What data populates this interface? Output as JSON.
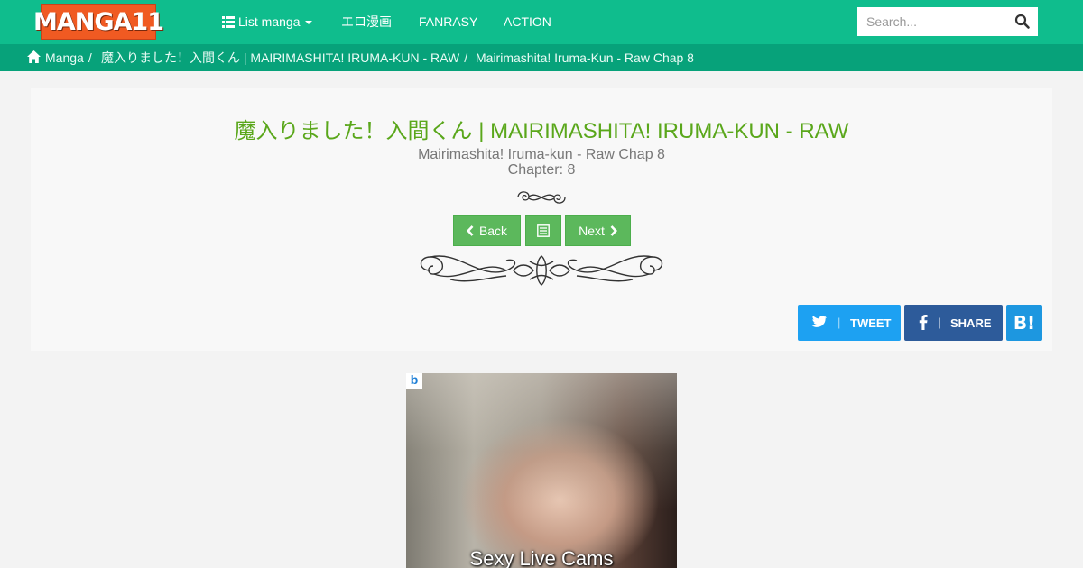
{
  "navbar": {
    "logo_text": "MANGA11",
    "links": {
      "list_manga": "List manga",
      "ero": "エロ漫画",
      "fanrasy": "FANRASY",
      "action": "ACTION"
    },
    "search_placeholder": "Search..."
  },
  "breadcrumb": {
    "items": [
      "Manga",
      "魔入りました！入間くん | MAIRIMASHITA! IRUMA-KUN - RAW",
      "Mairimashita! Iruma-Kun - Raw Chap 8"
    ]
  },
  "chapter": {
    "manga_title": "魔入りました！入間くん | MAIRIMASHITA! IRUMA-KUN - RAW",
    "chapter_title": "Mairimashita! Iruma-kun - Raw Chap 8",
    "chapter_number": "Chapter: 8",
    "back_label": "Back",
    "next_label": "Next"
  },
  "share": {
    "tweet_label": "TWEET",
    "share_label": "SHARE",
    "hatena_label": "B!"
  },
  "ad": {
    "badge": "b",
    "caption": "Sexy Live Cams"
  },
  "colors": {
    "navbar": "#0fbd8d",
    "breadcrumb": "#07a27a",
    "title": "#5aa71b",
    "button": "#5cb85c",
    "twitter": "#1da1f2",
    "facebook": "#2d5b9a",
    "hatena": "#1d97e0",
    "logo": "#f05a22"
  },
  "icons": [
    "list-icon",
    "caret-down-icon",
    "search-icon",
    "home-icon",
    "chevron-left-icon",
    "list-alt-icon",
    "chevron-right-icon",
    "twitter-icon",
    "facebook-icon",
    "hatena-icon"
  ]
}
